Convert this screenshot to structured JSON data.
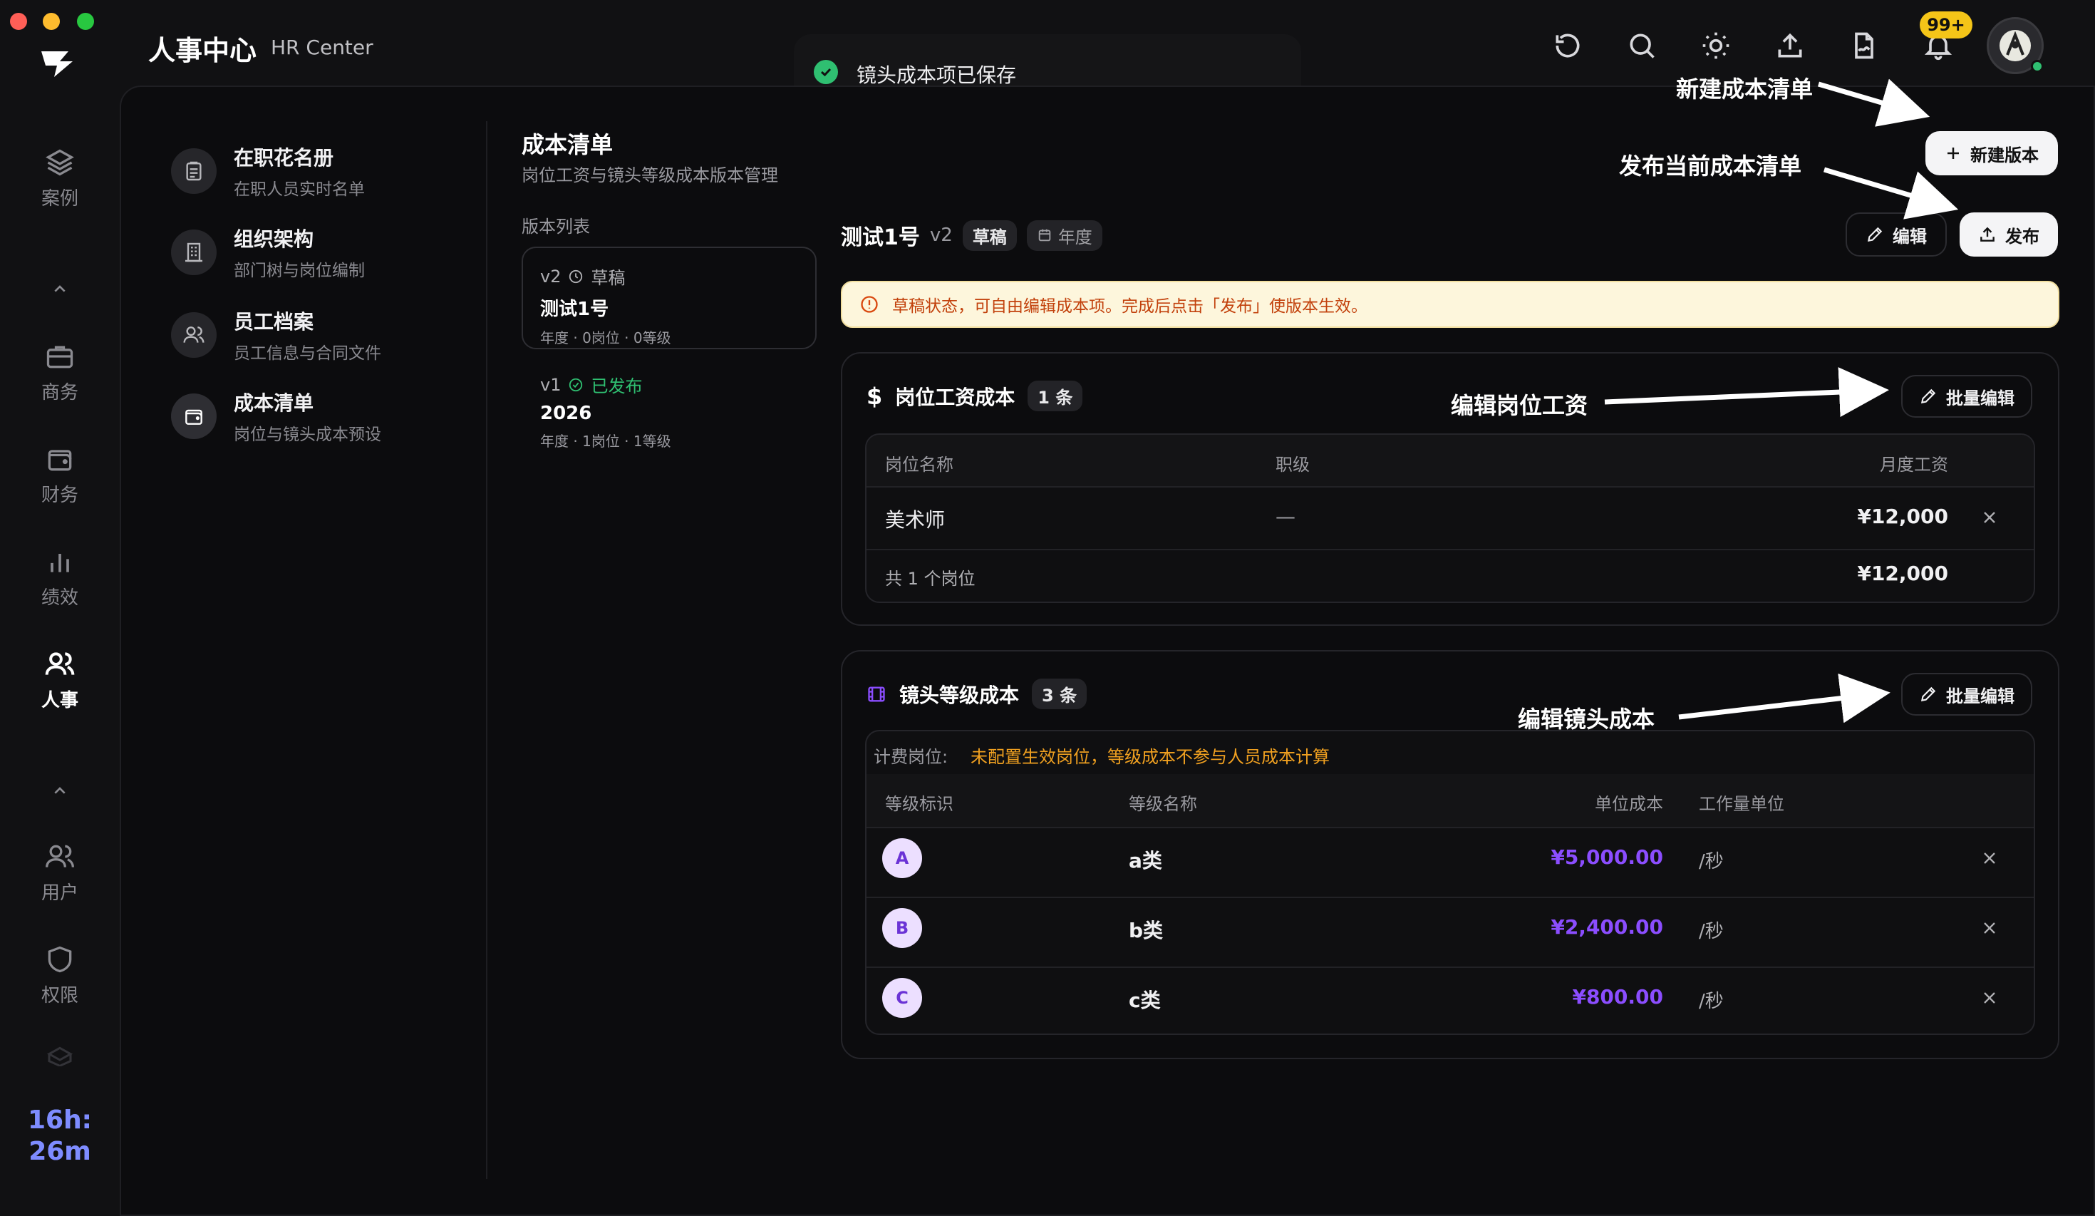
{
  "app": {
    "title": "人事中心",
    "subtitle": "HR Center",
    "notification_badge": "99+",
    "timer": "16h:\n26m"
  },
  "toast": {
    "message": "镜头成本项已保存"
  },
  "rail": {
    "items": [
      {
        "label": "案例",
        "icon": "layers-icon"
      },
      {
        "label": "商务",
        "icon": "briefcase-icon"
      },
      {
        "label": "财务",
        "icon": "wallet-icon"
      },
      {
        "label": "绩效",
        "icon": "bar-chart-icon"
      },
      {
        "label": "人事",
        "icon": "people-icon",
        "active": true
      },
      {
        "label": "用户",
        "icon": "users-icon"
      },
      {
        "label": "权限",
        "icon": "shield-icon"
      }
    ]
  },
  "subnav": {
    "items": [
      {
        "title": "在职花名册",
        "sub": "在职人员实时名单",
        "icon": "clipboard-icon"
      },
      {
        "title": "组织架构",
        "sub": "部门树与岗位编制",
        "icon": "building-icon"
      },
      {
        "title": "员工档案",
        "sub": "员工信息与合同文件",
        "icon": "users-icon"
      },
      {
        "title": "成本清单",
        "sub": "岗位与镜头成本预设",
        "icon": "wallet-icon"
      }
    ]
  },
  "cost_list": {
    "title": "成本清单",
    "subtitle": "岗位工资与镜头等级成本版本管理",
    "version_list_label": "版本列表",
    "versions": [
      {
        "ver": "v2",
        "status": "草稿",
        "name": "测试1号",
        "meta": "年度 · 0岗位 · 0等级"
      },
      {
        "ver": "v1",
        "status": "已发布",
        "name": "2026",
        "meta": "年度 · 1岗位 · 1等级"
      }
    ]
  },
  "detail": {
    "name": "测试1号",
    "ver": "v2",
    "status_tag": "草稿",
    "period_tag": "年度",
    "edit_label": "编辑",
    "publish_label": "发布",
    "new_version_label": "新建版本",
    "notice": "草稿状态，可自由编辑成本项。完成后点击「发布」使版本生效。"
  },
  "salary": {
    "title": "岗位工资成本",
    "count": "1 条",
    "batch_edit": "批量编辑",
    "headers": {
      "name": "岗位名称",
      "level": "职级",
      "monthly": "月度工资"
    },
    "rows": [
      {
        "name": "美术师",
        "level": "—",
        "monthly": "¥12,000"
      }
    ],
    "footer_label": "共 1 个岗位",
    "footer_total": "¥12,000"
  },
  "shot": {
    "title": "镜头等级成本",
    "count": "3 条",
    "batch_edit": "批量编辑",
    "billing_label": "计费岗位:",
    "billing_warning": "未配置生效岗位，等级成本不参与人员成本计算",
    "headers": {
      "grade": "等级标识",
      "name": "等级名称",
      "unit_cost": "单位成本",
      "unit": "工作量单位"
    },
    "rows": [
      {
        "grade": "A",
        "name": "a类",
        "unit_cost": "¥5,000.00",
        "unit": "/秒"
      },
      {
        "grade": "B",
        "name": "b类",
        "unit_cost": "¥2,400.00",
        "unit": "/秒"
      },
      {
        "grade": "C",
        "name": "c类",
        "unit_cost": "¥800.00",
        "unit": "/秒"
      }
    ]
  },
  "annotations": {
    "new_list": "新建成本清单",
    "publish_list": "发布当前成本清单",
    "edit_salary": "编辑岗位工资",
    "edit_shot": "编辑镜头成本"
  },
  "colors": {
    "accent_purple": "#8b4dff",
    "warning_orange": "#f0a020",
    "success_green": "#2fbf71",
    "badge_yellow": "#f5c518"
  }
}
